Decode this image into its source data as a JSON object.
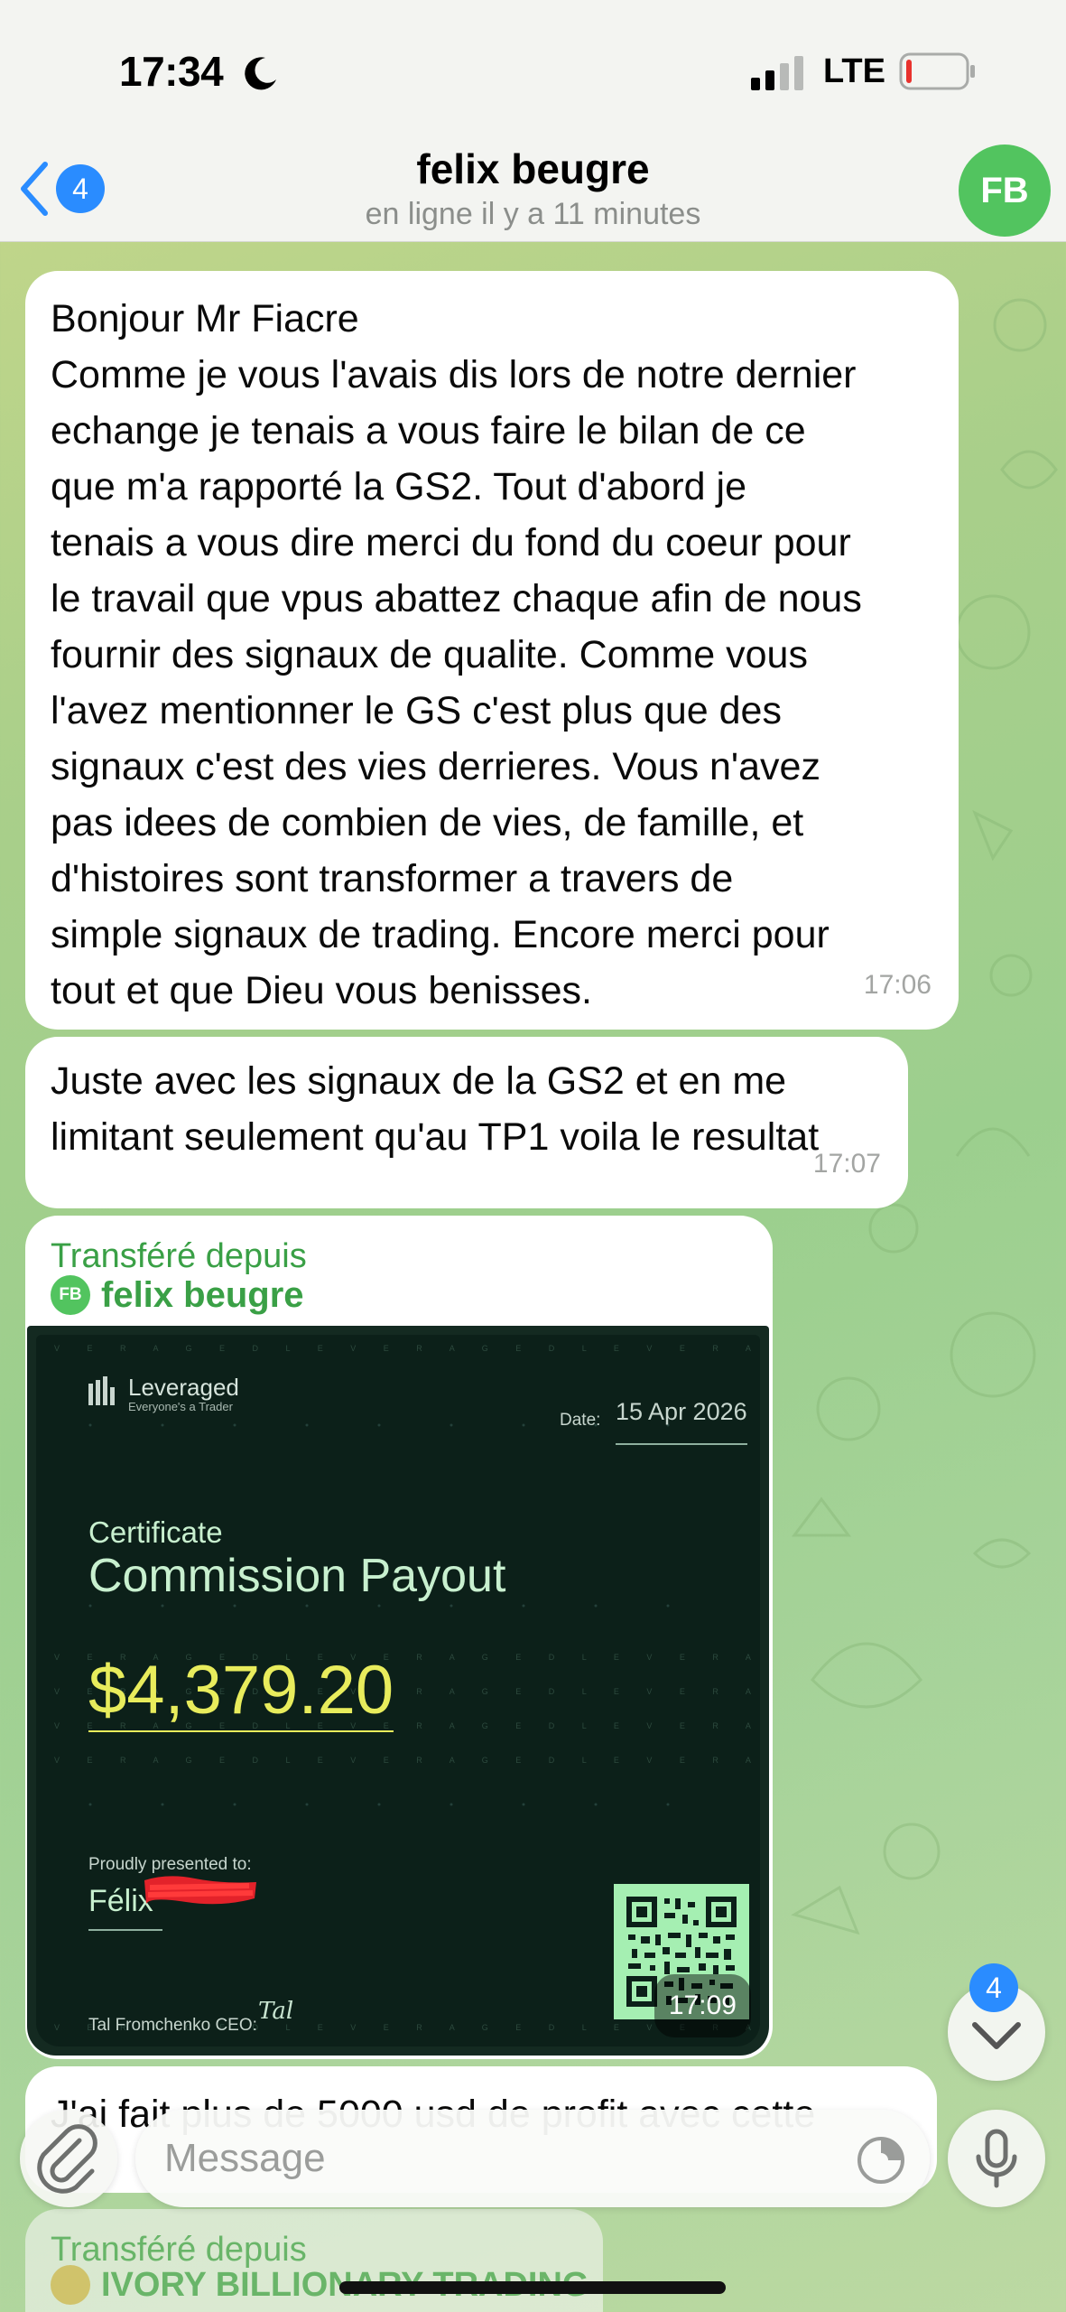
{
  "status_bar": {
    "time": "17:34",
    "network": "LTE"
  },
  "header": {
    "back_badge": "4",
    "title": "felix beugre",
    "subtitle": "en ligne il y a 11 minutes",
    "avatar_initials": "FB"
  },
  "messages": [
    {
      "text": "Bonjour Mr Fiacre\nComme je vous l'avais dis lors de notre dernier\nechange je tenais a vous faire le bilan de ce\nque m'a rapporté la GS2. Tout d'abord je\ntenais a vous dire merci du fond du coeur pour\nle travail que vpus abattez chaque afin de nous\nfournir des signaux de qualite. Comme vous\nl'avez mentionner le GS c'est plus que des\nsignaux c'est des vies derrieres. Vous n'avez\npas idees de combien de vies, de famille, et\nd'histoires sont transformer a travers de\nsimple signaux de trading. Encore merci pour\ntout et que Dieu vous benisses.",
      "time": "17:06"
    },
    {
      "text": "Juste avec les signaux de la GS2 et en me\nlimitant seulement qu'au TP1 voila le resultat",
      "time": "17:07"
    },
    {
      "forwarded_label": "Transféré depuis",
      "forwarded_from": "felix beugre",
      "forwarded_initials": "FB",
      "time": "17:09",
      "certificate": {
        "brand": "Leveraged",
        "tagline": "Everyone's a Trader",
        "date_label": "Date:",
        "date": "15 Apr 2026",
        "label": "Certificate",
        "title": "Commission Payout",
        "amount": "$4,379.20",
        "presented_label": "Proudly presented to:",
        "recipient": "Félix",
        "ceo_label": "Tal Fromchenko CEO:",
        "signature": "Tal Fromchenko",
        "pattern_text": "V E R A G E D L E V E R A G E D L E V E R A G"
      }
    },
    {
      "text": "J'ai fait plus de 5000 usd de profit avec cette"
    },
    {
      "forwarded_label": "Transféré depuis",
      "forwarded_from": "IVORY BILLIONARY TRADING"
    }
  ],
  "scroll_button": {
    "badge": "4"
  },
  "composer": {
    "placeholder": "Message"
  },
  "icons": [
    "moon-icon",
    "signal-icon",
    "battery-icon",
    "back-chevron-icon",
    "chevron-down-icon",
    "paperclip-icon",
    "sticker-icon",
    "microphone-icon"
  ],
  "colors": {
    "accent_blue": "#2a8cff",
    "forward_green": "#3aa046",
    "avatar_green": "#52c45f",
    "certificate_amount": "#e8ec5c"
  }
}
